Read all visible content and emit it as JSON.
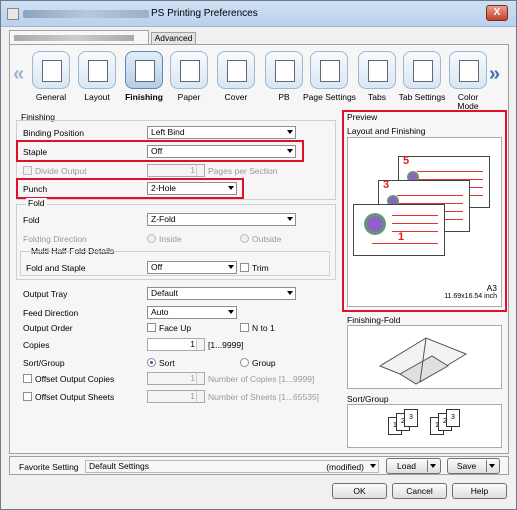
{
  "window": {
    "title": "PS Printing Preferences",
    "close": "X"
  },
  "tabs": {
    "advanced": "Advanced"
  },
  "icons": [
    {
      "label": "General",
      "icon": "general-icon"
    },
    {
      "label": "Layout",
      "icon": "layout-icon"
    },
    {
      "label": "Finishing",
      "icon": "finishing-icon",
      "selected": true
    },
    {
      "label": "Paper",
      "icon": "paper-icon"
    },
    {
      "label": "Cover",
      "icon": "cover-icon"
    },
    {
      "label": "PB",
      "icon": "pb-icon"
    },
    {
      "label": "Page Settings",
      "icon": "page-settings-icon"
    },
    {
      "label": "Tabs",
      "icon": "tabs-icon"
    },
    {
      "label": "Tab Settings",
      "icon": "tab-settings-icon"
    },
    {
      "label": "Color\nMode",
      "icon": "color-mode-icon"
    }
  ],
  "finishing": {
    "section": "Finishing",
    "binding_label": "Binding Position",
    "binding_value": "Left Bind",
    "staple_label": "Staple",
    "staple_value": "Off",
    "divide_label": "Divide Output",
    "divide_value": "1",
    "divide_unit": "Pages per Section",
    "punch_label": "Punch",
    "punch_value": "2-Hole"
  },
  "fold": {
    "section": "Fold",
    "fold_label": "Fold",
    "fold_value": "Z-Fold",
    "direction_label": "Folding Direction",
    "inside": "Inside",
    "outside": "Outside",
    "multi_label": "Multi Half-Fold Details",
    "fold_staple_label": "Fold and Staple",
    "fold_staple_value": "Off",
    "trim": "Trim"
  },
  "output": {
    "tray_label": "Output Tray",
    "tray_value": "Default",
    "feed_label": "Feed Direction",
    "feed_value": "Auto",
    "order_label": "Output Order",
    "face_up": "Face Up",
    "n_to_1": "N to 1",
    "copies_label": "Copies",
    "copies_value": "1",
    "copies_range": "[1...9999]",
    "sort_label": "Sort/Group",
    "sort": "Sort",
    "group": "Group",
    "offset_copies": "Offset Output Copies",
    "offset_copies_value": "1",
    "offset_copies_hint": "Number of Copies [1...9999]",
    "offset_sheets": "Offset Output Sheets",
    "offset_sheets_value": "1",
    "offset_sheets_hint": "Number of Sheets [1...65535]"
  },
  "preview": {
    "section": "Preview",
    "layout_label": "Layout and Finishing",
    "paper_size": "A3",
    "paper_dims": "11.69x16.54 inch",
    "page_numbers": [
      "5",
      "3",
      "1"
    ],
    "finishing_fold_label": "Finishing-Fold",
    "sort_group_label": "Sort/Group"
  },
  "bottom": {
    "favorite_label": "Favorite Setting",
    "favorite_value": "Default Settings",
    "modified": "(modified)",
    "load": "Load",
    "save": "Save",
    "ok": "OK",
    "cancel": "Cancel",
    "help": "Help"
  }
}
